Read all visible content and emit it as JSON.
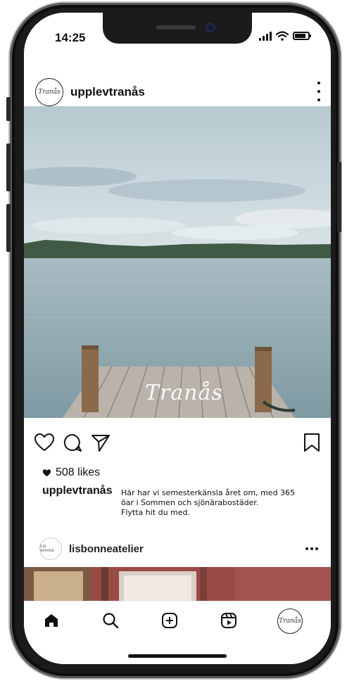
{
  "status_bar": {
    "time": "14:25",
    "battery_level": 0.85
  },
  "post": {
    "username": "upplevtranås",
    "avatar_text": "Tranås",
    "photo_watermark": "Tranås",
    "likes_text": "508 likes",
    "caption_username": "upplevtranås",
    "caption_lines": [
      "Här har vi semesterkänsla året om, med 365",
      "öar i Sommen och sjönärabostäder.",
      "Flytta hit du med."
    ]
  },
  "next_post": {
    "username": "lisbonneatelier",
    "avatar_text": "LIS BONNE"
  },
  "tabbar": {
    "items": [
      "home-icon",
      "search-icon",
      "new-post-icon",
      "reels-icon",
      "profile-avatar"
    ],
    "profile_avatar_text": "Tranås"
  },
  "colors": {
    "sky": "#c9d8de",
    "water": "#8aa5ad",
    "treeline": "#3f5a45",
    "dock": "#b9b3ab",
    "next_photo": "#9a4a45"
  }
}
